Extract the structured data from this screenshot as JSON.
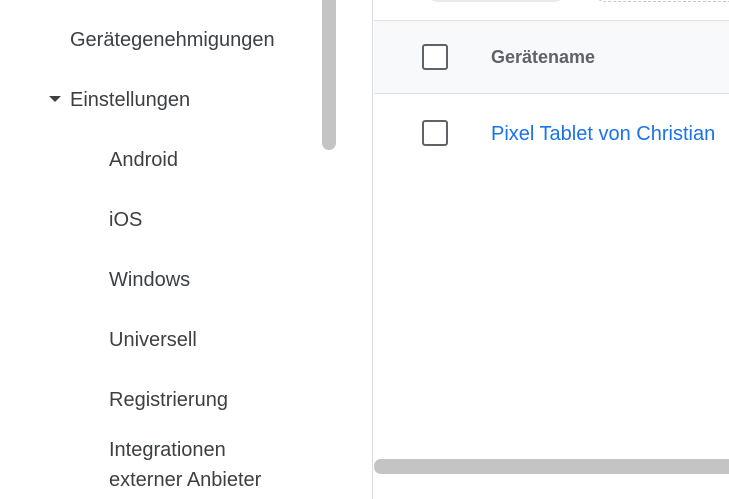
{
  "sidebar": {
    "items": [
      {
        "label": "Gerätegenehmigungen"
      },
      {
        "label": "Einstellungen",
        "expanded": true
      },
      {
        "label": "Android"
      },
      {
        "label": "iOS"
      },
      {
        "label": "Windows"
      },
      {
        "label": "Universell"
      },
      {
        "label": "Registrierung"
      },
      {
        "label": "Integrationen externer Anbieter"
      }
    ]
  },
  "table": {
    "columns": [
      "Gerätename"
    ],
    "rows": [
      {
        "device_name": "Pixel Tablet von Christian"
      }
    ]
  },
  "colors": {
    "link": "#1a73e8",
    "header_bg": "#f8f9fa",
    "scrollbar": "#c4c4c4"
  }
}
